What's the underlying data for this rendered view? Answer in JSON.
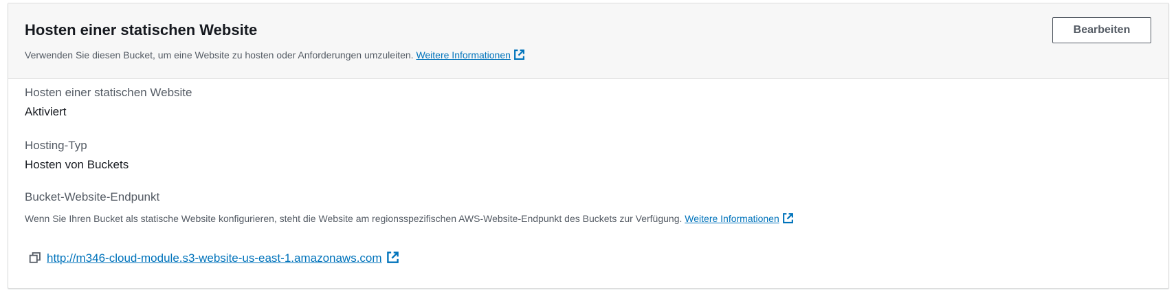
{
  "colors": {
    "link": "#0073bb",
    "header_bg": "#f7f7f7",
    "label": "#545b64",
    "text": "#16191f",
    "border": "#dcdcdc"
  },
  "header": {
    "title": "Hosten einer statischen Website",
    "description": "Verwenden Sie diesen Bucket, um eine Website zu hosten oder Anforderungen umzuleiten.",
    "learn_more": "Weitere Informationen",
    "learn_more_icon": "external-link-icon",
    "edit_button": "Bearbeiten"
  },
  "fields": {
    "hosting": {
      "label": "Hosten einer statischen Website",
      "value": "Aktiviert"
    },
    "hosting_type": {
      "label": "Hosting-Typ",
      "value": "Hosten von Buckets"
    },
    "endpoint": {
      "label": "Bucket-Website-Endpunkt",
      "description": "Wenn Sie Ihren Bucket als statische Website konfigurieren, steht die Website am regionsspezifischen AWS-Website-Endpunkt des Buckets zur Verfügung.",
      "learn_more": "Weitere Informationen",
      "url": "http://m346-cloud-module.s3-website-us-east-1.amazonaws.com",
      "copy_icon": "copy-icon",
      "external_icon": "external-link-icon"
    }
  }
}
